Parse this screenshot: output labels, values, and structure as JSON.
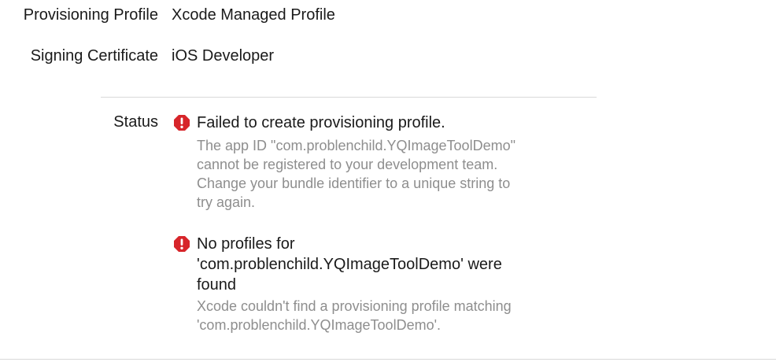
{
  "signing": {
    "provisioning_profile": {
      "label": "Provisioning Profile",
      "value": "Xcode Managed Profile"
    },
    "signing_certificate": {
      "label": "Signing Certificate",
      "value": "iOS Developer"
    },
    "status": {
      "label": "Status",
      "issues": [
        {
          "title": "Failed to create provisioning profile.",
          "detail_lines": [
            "The app ID \"com.problenchild.YQImageToolDemo\"",
            "cannot be registered to your development team.",
            "Change your bundle identifier to a unique string to",
            "try again."
          ]
        },
        {
          "title_lines": [
            "No profiles for",
            "'com.problenchild.YQImageToolDemo' were",
            "found"
          ],
          "detail_lines": [
            "Xcode couldn't find a provisioning profile matching",
            "'com.problenchild.YQImageToolDemo'."
          ]
        }
      ]
    }
  },
  "colors": {
    "error_icon": "#d7252a",
    "detail_text": "#8e8e8e",
    "divider": "#d9d9d9"
  },
  "icons": {
    "issue": "error-icon"
  }
}
